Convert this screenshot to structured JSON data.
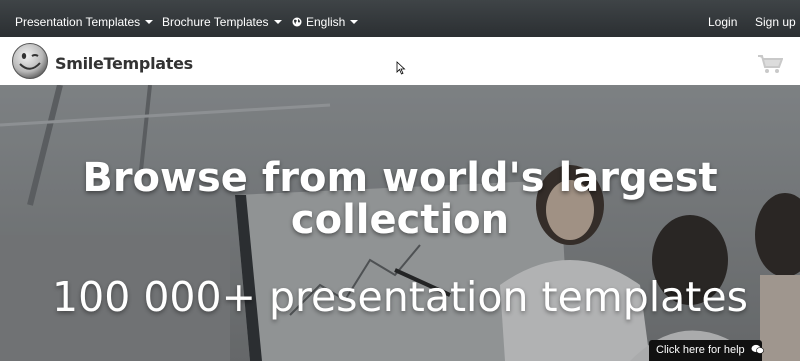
{
  "topnav": {
    "presentation_templates": "Presentation Templates",
    "brochure_templates": "Brochure Templates",
    "language": "English",
    "login": "Login",
    "signup": "Sign up"
  },
  "brand": {
    "name": "SmileTemplates"
  },
  "hero": {
    "title": "Browse from world's largest collection",
    "subtitle": "100 000+ presentation templates"
  },
  "help": {
    "label": "Click here for help"
  },
  "icons": {
    "globe": "globe-icon",
    "cart": "cart-icon",
    "chat": "chat-icon",
    "logo": "smiley-logo"
  },
  "colors": {
    "topbar": "#2f3336",
    "text_light": "#ffffff",
    "brand_text": "#333333",
    "help_bg": "#111111"
  }
}
